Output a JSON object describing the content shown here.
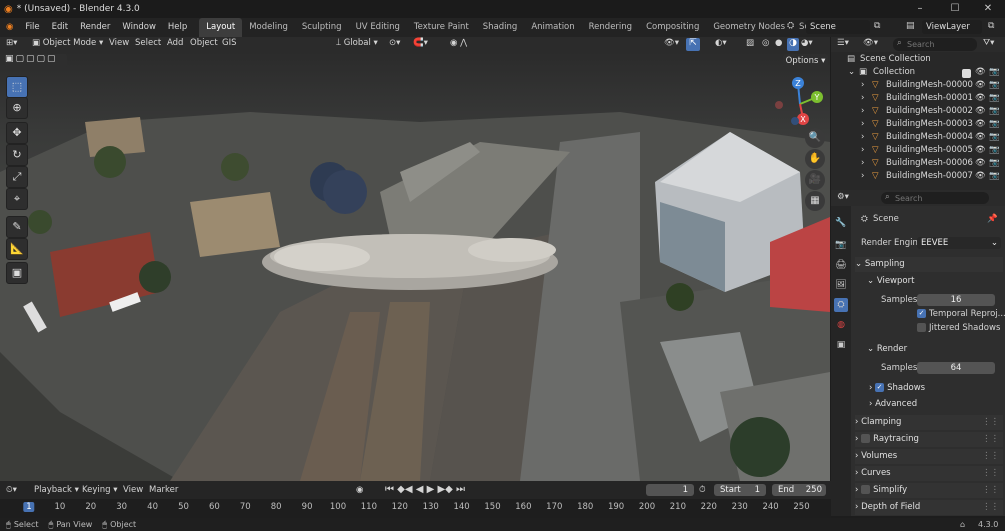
{
  "titlebar": {
    "title": "* (Unsaved) - Blender 4.3.0",
    "min": "–",
    "max": "☐",
    "close": "✕"
  },
  "menu": [
    "File",
    "Edit",
    "Render",
    "Window",
    "Help"
  ],
  "workspaces": [
    "Layout",
    "Modeling",
    "Sculpting",
    "UV Editing",
    "Texture Paint",
    "Shading",
    "Animation",
    "Rendering",
    "Compositing",
    "Geometry Nodes",
    "Scripting"
  ],
  "workspace_add": "+",
  "scene": {
    "name": "Scene",
    "view_layer": "ViewLayer"
  },
  "viewport_header": {
    "mode": "Object Mode",
    "menus": [
      "View",
      "Select",
      "Add",
      "Object",
      "GIS"
    ],
    "transform": "Global",
    "options": "Options"
  },
  "outliner": {
    "search_placeholder": "Search",
    "root": "Scene Collection",
    "collection": "Collection",
    "items": [
      "BuildingMesh-00000",
      "BuildingMesh-00001",
      "BuildingMesh-00002",
      "BuildingMesh-00003",
      "BuildingMesh-00004",
      "BuildingMesh-00005",
      "BuildingMesh-00006",
      "BuildingMesh-00007"
    ]
  },
  "properties": {
    "search_placeholder": "Search",
    "scene_label": "Scene",
    "render_engine_label": "Render Engine",
    "render_engine": "EEVEE",
    "sampling": "Sampling",
    "viewport": "Viewport",
    "viewport_samples_label": "Samples",
    "viewport_samples": "16",
    "temporal_reprojection": "Temporal Reproj...",
    "jittered_shadows": "Jittered Shadows",
    "render": "Render",
    "render_samples_label": "Samples",
    "render_samples": "64",
    "shadows": "Shadows",
    "advanced": "Advanced",
    "sections": [
      "Clamping",
      "Raytracing",
      "Volumes",
      "Curves",
      "Simplify",
      "Depth of Field"
    ]
  },
  "timeline": {
    "menus": [
      "Playback",
      "Keying",
      "View",
      "Marker"
    ],
    "current_frame": "1",
    "start_label": "Start",
    "start": "1",
    "end_label": "End",
    "end": "250",
    "ticks": [
      "1",
      "10",
      "20",
      "30",
      "40",
      "50",
      "60",
      "70",
      "80",
      "90",
      "100",
      "110",
      "120",
      "130",
      "140",
      "150",
      "160",
      "170",
      "180",
      "190",
      "200",
      "210",
      "220",
      "230",
      "240",
      "250"
    ]
  },
  "status": {
    "select": "Select",
    "pan": "Pan View",
    "object": "Object",
    "version": "4.3.0"
  },
  "axis": {
    "x": "X",
    "y": "Y",
    "z": "Z"
  },
  "colors": {
    "accent": "#4772b3",
    "x_axis": "#e04545",
    "y_axis": "#7cbf2f",
    "z_axis": "#3b82d8"
  }
}
